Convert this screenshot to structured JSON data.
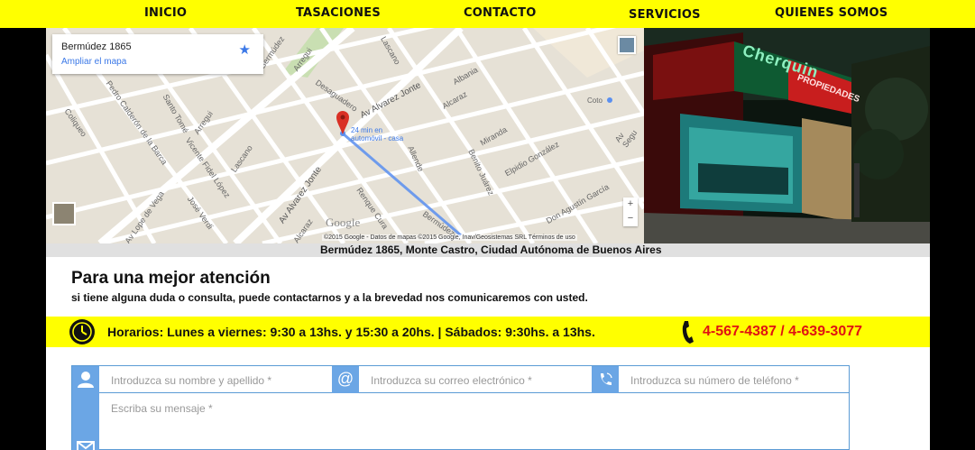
{
  "nav": {
    "items": [
      {
        "label": "INICIO"
      },
      {
        "label": "TASACIONES"
      },
      {
        "label": "CONTACTO"
      },
      {
        "label": "SERVICIOS"
      },
      {
        "label": "QUIENES SOMOS"
      }
    ]
  },
  "map": {
    "card_title": "Bermúdez 1865",
    "card_link": "Ampliar el mapa",
    "route_label_line1": "24 min en",
    "route_label_line2": "automóvil - casa",
    "google_logo": "Google",
    "footer": "©2015 Google - Datos de mapas ©2015 Google, Inav/Geosistemas SRL    Términos de uso",
    "zoom_in": "+",
    "zoom_out": "−",
    "streets": [
      {
        "name": "Av Alvarez Jonte"
      },
      {
        "name": "Av Alvarez Jonte"
      },
      {
        "name": "Desaguadero"
      },
      {
        "name": "Albania"
      },
      {
        "name": "Alcaraz"
      },
      {
        "name": "Miranda"
      },
      {
        "name": "Allende"
      },
      {
        "name": "Benito Juárez"
      },
      {
        "name": "Elpidio González"
      },
      {
        "name": "Don Agustín García"
      },
      {
        "name": "Bermúdez"
      },
      {
        "name": "Pedro Calderón de la Barca"
      },
      {
        "name": "Santo Tomé"
      },
      {
        "name": "Vicente Fidel López"
      },
      {
        "name": "Lascano"
      },
      {
        "name": "Arregui"
      },
      {
        "name": "Coliqueo"
      },
      {
        "name": "Av Lope de Vega"
      },
      {
        "name": "José Verdi"
      },
      {
        "name": "Renque Cura"
      },
      {
        "name": "Av Segu"
      },
      {
        "name": "Coto"
      },
      {
        "name": "Lascano"
      },
      {
        "name": "Bermúdez"
      },
      {
        "name": "Alcaraz"
      },
      {
        "name": "Arregui"
      }
    ]
  },
  "photo": {
    "sign_text": "Cherquin",
    "sign_red": "PROPIEDADES"
  },
  "caption": "Bermúdez 1865, Monte Castro, Ciudad Autónoma de Buenos Aires",
  "contact": {
    "heading": "Para una mejor atención",
    "subtext": "si tiene alguna duda o consulta, puede contactarnos y a la brevedad nos comunicaremos con usted.",
    "hours": "Horarios: Lunes a viernes: 9:30 a 13hs. y 15:30 a 20hs.  |  Sábados: 9:30hs. a 13hs.",
    "phones": "4-567-4387 / 4-639-3077"
  },
  "form": {
    "name_placeholder": "Introduzca su nombre y apellido *",
    "email_placeholder": "Introduzca su correo electrónico *",
    "phone_placeholder": "Introduzca su número de teléfono *",
    "message_placeholder": "Escriba su mensaje *"
  },
  "colors": {
    "accent_yellow": "#ffff00",
    "phone_red": "#e01212",
    "form_blue": "#6ba6e5"
  }
}
